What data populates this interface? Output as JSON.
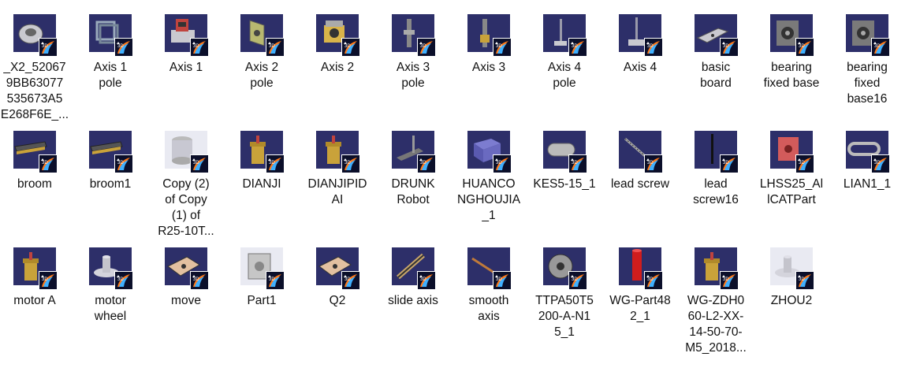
{
  "files": [
    {
      "label": "_X2_52067\n9BB63077\n535673A5\nE268F6E_...",
      "icon": "gear-ring-part-icon",
      "thumb_bg": "dark"
    },
    {
      "label": "Axis 1\npole",
      "icon": "frame-part-icon",
      "thumb_bg": "dark"
    },
    {
      "label": "Axis 1",
      "icon": "assembly-part-icon",
      "thumb_bg": "dark"
    },
    {
      "label": "Axis 2\npole",
      "icon": "bracket-part-icon",
      "thumb_bg": "dark"
    },
    {
      "label": "Axis 2",
      "icon": "motor-bracket-part-icon",
      "thumb_bg": "dark"
    },
    {
      "label": "Axis 3\npole",
      "icon": "pole-part-icon",
      "thumb_bg": "dark"
    },
    {
      "label": "Axis 3",
      "icon": "pole-motor-part-icon",
      "thumb_bg": "dark"
    },
    {
      "label": "Axis 4\npole",
      "icon": "thin-pole-part-icon",
      "thumb_bg": "dark"
    },
    {
      "label": "Axis 4",
      "icon": "thin-pole-base-part-icon",
      "thumb_bg": "dark"
    },
    {
      "label": "basic\nboard",
      "icon": "plate-part-icon",
      "thumb_bg": "dark"
    },
    {
      "label": "bearing\nfixed base",
      "icon": "bearing-base-part-icon",
      "thumb_bg": "dark"
    },
    {
      "label": "bearing\nfixed\nbase16",
      "icon": "bearing-base-part-icon",
      "thumb_bg": "dark"
    },
    {
      "label": "broom",
      "icon": "broom-part-icon",
      "thumb_bg": "dark"
    },
    {
      "label": "broom1",
      "icon": "broom-part-icon",
      "thumb_bg": "dark"
    },
    {
      "label": "Copy (2)\nof Copy\n(1) of\nR25-10T...",
      "icon": "cylinder-part-icon",
      "thumb_bg": "light"
    },
    {
      "label": "DIANJI",
      "icon": "motor-part-icon",
      "thumb_bg": "dark"
    },
    {
      "label": "DIANJIPID\nAI",
      "icon": "motor-part-icon",
      "thumb_bg": "dark"
    },
    {
      "label": "DRUNK\nRobot",
      "icon": "robot-part-icon",
      "thumb_bg": "dark"
    },
    {
      "label": "HUANCO\nNGHOUJIA\n_1",
      "icon": "block-part-icon",
      "thumb_bg": "dark"
    },
    {
      "label": "KES5-15_1",
      "icon": "slot-part-icon",
      "thumb_bg": "dark"
    },
    {
      "label": "lead screw",
      "icon": "screw-part-icon",
      "thumb_bg": "dark"
    },
    {
      "label": "lead\nscrew16",
      "icon": "vertical-rod-part-icon",
      "thumb_bg": "dark"
    },
    {
      "label": "LHSS25_Al\nlCATPart",
      "icon": "red-block-part-icon",
      "thumb_bg": "dark"
    },
    {
      "label": "LIAN1_1",
      "icon": "chain-link-part-icon",
      "thumb_bg": "dark"
    },
    {
      "label": "motor A",
      "icon": "motor-part-icon",
      "thumb_bg": "dark"
    },
    {
      "label": "motor\nwheel",
      "icon": "wheel-part-icon",
      "thumb_bg": "dark"
    },
    {
      "label": "move",
      "icon": "move-plate-part-icon",
      "thumb_bg": "dark"
    },
    {
      "label": "Part1",
      "icon": "cube-part-icon",
      "thumb_bg": "light"
    },
    {
      "label": "Q2",
      "icon": "move-plate-part-icon",
      "thumb_bg": "dark"
    },
    {
      "label": "slide axis",
      "icon": "slide-rail-part-icon",
      "thumb_bg": "dark"
    },
    {
      "label": "smooth\naxis",
      "icon": "rod-part-icon",
      "thumb_bg": "dark"
    },
    {
      "label": "TTPA50T5\n200-A-N1\n5_1",
      "icon": "pulley-part-icon",
      "thumb_bg": "dark"
    },
    {
      "label": "WG-Part48\n2_1",
      "icon": "red-cylinder-part-icon",
      "thumb_bg": "dark"
    },
    {
      "label": "WG-ZDH0\n60-L2-XX-\n14-50-70-\nM5_2018...",
      "icon": "motor-part-icon",
      "thumb_bg": "dark"
    },
    {
      "label": "ZHOU2",
      "icon": "wheel-part-icon",
      "thumb_bg": "light"
    }
  ],
  "badge_icon": "catia-app-icon"
}
